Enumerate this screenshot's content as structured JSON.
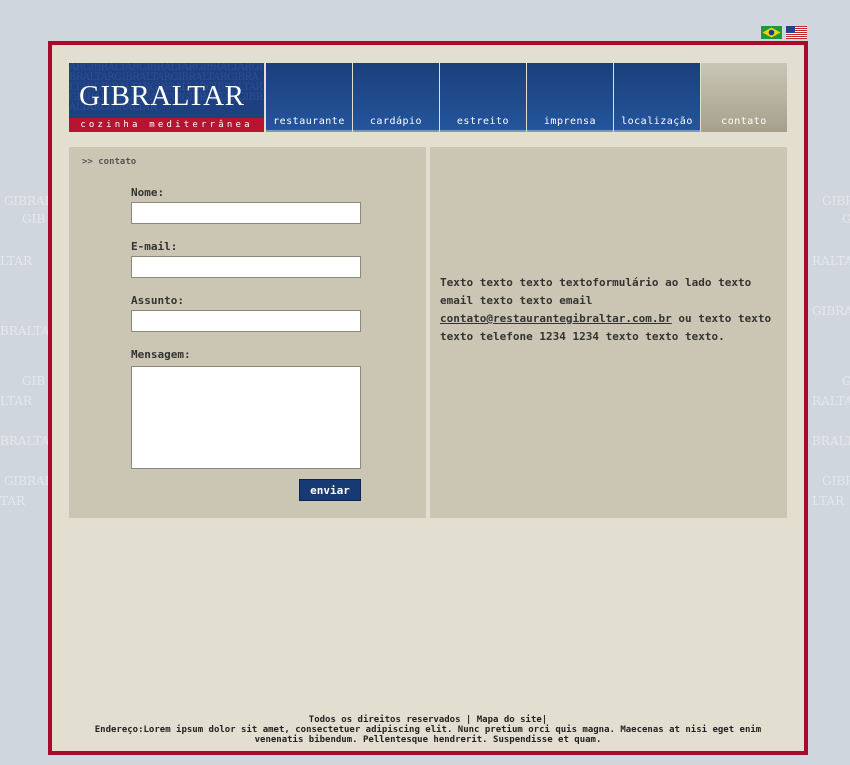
{
  "watermark": "GIBRALTAR",
  "flags": [
    {
      "name": "brazil-flag-icon"
    },
    {
      "name": "usa-flag-icon"
    }
  ],
  "logo": {
    "name": "GIBRALTAR",
    "tagline": "cozinha mediterrânea",
    "pattern": "ARGIBRALTARGIBRALTARGIBRALTARGIBRALTARGIBRALTARGIBRALTARGIBRALTARGIBRALTARGIBRALTARGIBRALTARGIBRALTARGIBRALTARGIBRALTARGIBRALTARGIBRALTAR"
  },
  "nav": {
    "items": [
      {
        "label": "restaurante"
      },
      {
        "label": "cardápio"
      },
      {
        "label": "estreito"
      },
      {
        "label": "imprensa"
      },
      {
        "label": "localização"
      },
      {
        "label": "contato"
      }
    ],
    "active": "contato"
  },
  "breadcrumb": ">> contato",
  "form": {
    "name_label": "Nome:",
    "email_label": "E-mail:",
    "subject_label": "Assunto:",
    "message_label": "Mensagem:",
    "submit_label": "enviar"
  },
  "info": {
    "text_before": "Texto texto texto textoformulário ao lado texto email texto texto email ",
    "email": "contato@restaurantegibraltar.com.br",
    "text_middle": " ou texto texto texto telefone ",
    "phone": "1234 1234",
    "text_after": " texto texto texto."
  },
  "footer": {
    "line1": "Todos os direitos reservados | Mapa do site|",
    "line2": "Endereço:Lorem ipsum dolor sit amet, consectetuer adipiscing elit. Nunc pretium orci quis magna. Maecenas at nisi eget enim venenatis bibendum. Pellentesque hendrerit. Suspendisse et quam."
  },
  "colors": {
    "page_bg": "#cfd6de",
    "frame_border": "#a80a2c",
    "content_bg": "#e2dfd1",
    "panel_bg": "#cbc6b3",
    "nav_blue": "#1b3f7a",
    "tag_red": "#b81432"
  }
}
